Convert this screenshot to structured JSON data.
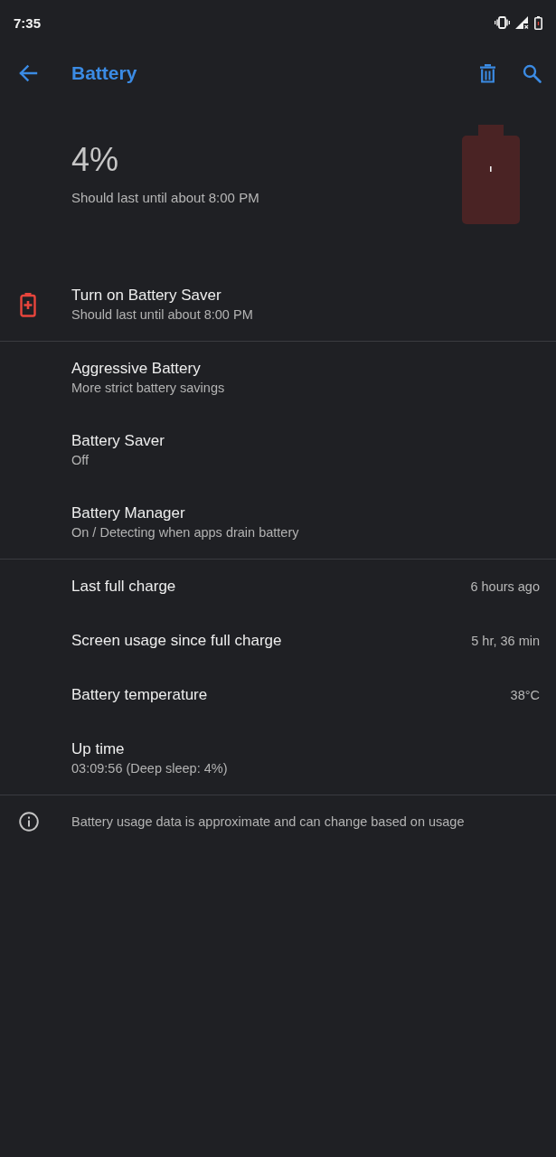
{
  "status_bar": {
    "time": "7:35"
  },
  "toolbar": {
    "title": "Battery"
  },
  "summary": {
    "percentage": "4%",
    "estimate": "Should last until about 8:00 PM"
  },
  "sections": [
    {
      "items": [
        {
          "kind": "suggestion",
          "title": "Turn on Battery Saver",
          "subtitle": "Should last until about 8:00 PM"
        }
      ]
    },
    {
      "items": [
        {
          "kind": "setting",
          "title": "Aggressive Battery",
          "subtitle": "More strict battery savings"
        },
        {
          "kind": "setting",
          "title": "Battery Saver",
          "subtitle": "Off"
        },
        {
          "kind": "setting",
          "title": "Battery Manager",
          "subtitle": "On / Detecting when apps drain battery"
        }
      ]
    },
    {
      "items": [
        {
          "kind": "stat",
          "title": "Last full charge",
          "value": "6 hours ago"
        },
        {
          "kind": "stat",
          "title": "Screen usage since full charge",
          "value": "5 hr, 36 min"
        },
        {
          "kind": "stat",
          "title": "Battery temperature",
          "value": "38°C"
        },
        {
          "kind": "setting",
          "title": "Up time",
          "subtitle": "03:09:56 (Deep sleep: 4%)"
        }
      ]
    }
  ],
  "footer": {
    "text": "Battery usage data is approximate and can change based on usage"
  }
}
